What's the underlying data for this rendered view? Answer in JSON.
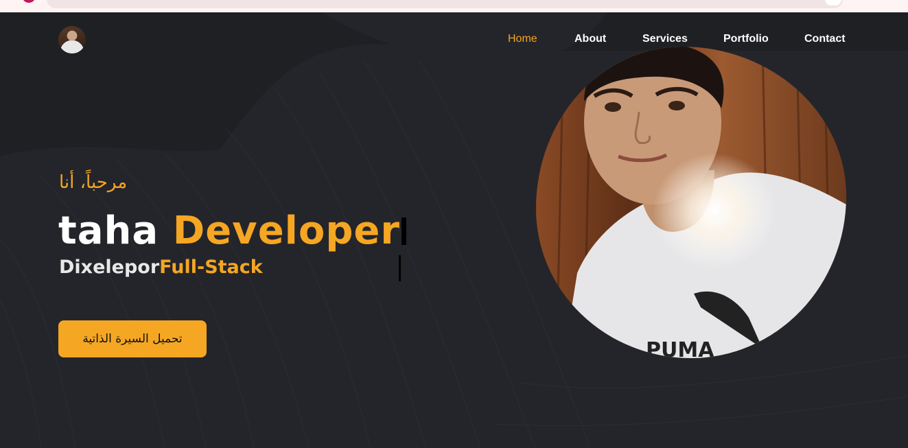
{
  "nav": {
    "items": [
      {
        "label": "Home",
        "active": true
      },
      {
        "label": "About",
        "active": false
      },
      {
        "label": "Services",
        "active": false
      },
      {
        "label": "Portfolio",
        "active": false
      },
      {
        "label": "Contact",
        "active": false
      }
    ]
  },
  "hero": {
    "greeting": "مرحباً، أنا",
    "name": "taha",
    "role": "Developer",
    "subtitle_part1": "Dixelepor",
    "subtitle_part2": "Full-Stack",
    "cv_button_label": "تحميل السيرة الذاتية"
  },
  "colors": {
    "background": "#1f2024",
    "accent": "#f5a623",
    "text": "#ffffff"
  },
  "icons": {
    "logo": "avatar-photo",
    "portrait": "profile-photo"
  }
}
